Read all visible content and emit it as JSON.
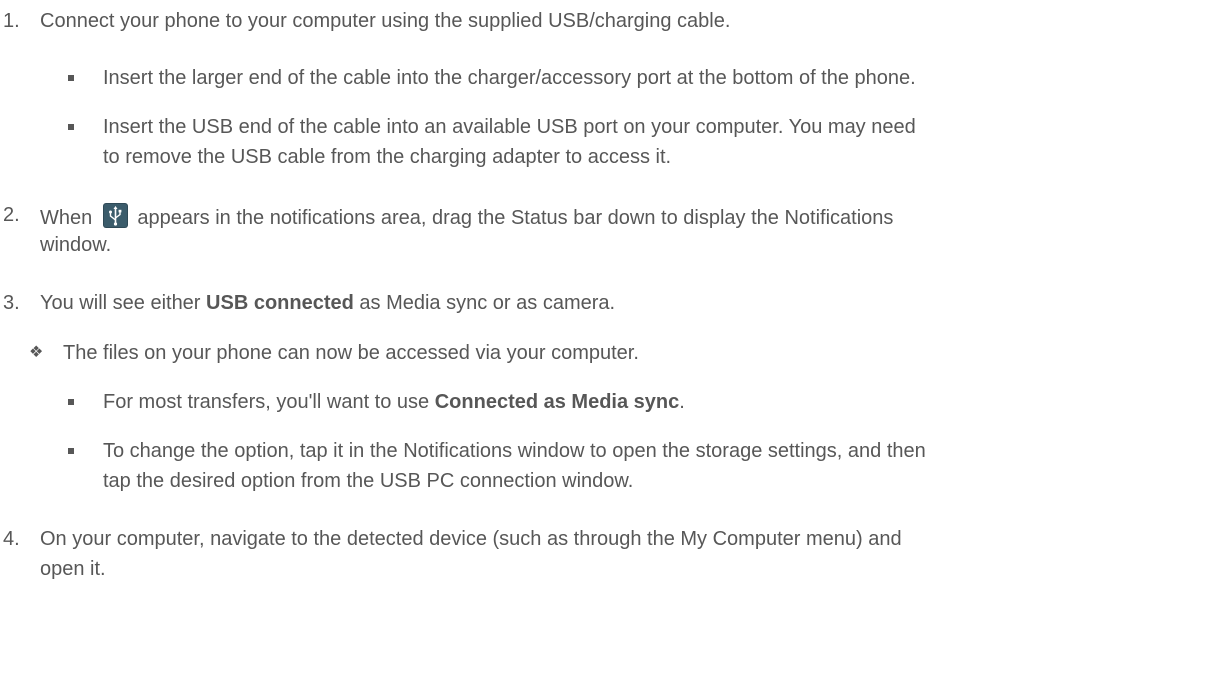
{
  "steps": [
    {
      "number": "1.",
      "text": "Connect your phone to your computer using the supplied USB/charging cable."
    },
    {
      "number": "2.",
      "text_before": "When",
      "text_after": "appears in the notifications area, drag the Status bar down to display the Notifications",
      "text_line2": "window."
    },
    {
      "number": "3.",
      "text_before": "You will see either",
      "bold": "USB connected",
      "text_after": "as Media sync or as camera."
    },
    {
      "number": "4.",
      "text_line1": "On your computer, navigate to the detected device (such as through the My Computer menu) and",
      "text_line2": "open it."
    }
  ],
  "step1_subitems": [
    {
      "text": "Insert the larger end of the cable into the charger/accessory port at the bottom of the phone."
    },
    {
      "text_line1": "Insert the USB end of the cable into an available USB port on your computer. You may need",
      "text_line2": "to remove the USB cable from the charging adapter to access it."
    }
  ],
  "step3_note": "The files on your phone can now be accessed via your computer.",
  "step3_subitems": [
    {
      "text_before": "For most transfers, you'll want to use",
      "bold": "Connected as Media sync",
      "text_after": "."
    },
    {
      "text_line1": "To change the option, tap it in the Notifications window to open the storage settings, and then",
      "text_line2": "tap the desired option from the USB PC connection window."
    }
  ],
  "icons": {
    "usb_notification": "usb-icon",
    "note_bullet": "diamond-bullet-icon",
    "sub_bullet": "square-bullet-icon"
  },
  "colors": {
    "text": "#575757",
    "usb_icon_bg": "#2f4a57",
    "usb_icon_fg": "#ffffff"
  }
}
